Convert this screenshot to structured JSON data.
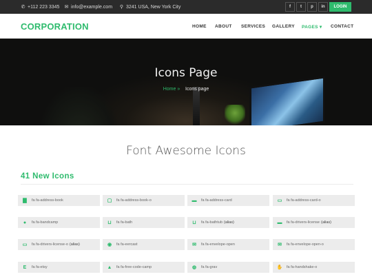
{
  "topbar": {
    "phone": "+112 223 3345",
    "email": "info@example.com",
    "address": "3241 USA, New York City",
    "social": [
      "f",
      "t",
      "p",
      "in"
    ],
    "login_label": "LOGIN"
  },
  "navbar": {
    "logo": "CORPORATION",
    "items": [
      {
        "label": "HOME"
      },
      {
        "label": "ABOUT"
      },
      {
        "label": "SERVICES"
      },
      {
        "label": "GALLERY"
      },
      {
        "label": "PAGES ▾"
      },
      {
        "label": "CONTACT"
      }
    ]
  },
  "hero": {
    "title": "Icons Page",
    "breadcrumb_home": "Home »",
    "breadcrumb_current": "Icons page"
  },
  "main": {
    "section_title": "Font Awesome Icons",
    "subsection_title": "41 New Icons",
    "icons": [
      {
        "label": "fa fa-address-book",
        "alias": "",
        "icon": "address-book-icon",
        "glyph": "▇"
      },
      {
        "label": "fa fa-address-book-o",
        "alias": "",
        "icon": "address-book-o-icon",
        "glyph": "▢"
      },
      {
        "label": "fa fa-address-card",
        "alias": "",
        "icon": "address-card-icon",
        "glyph": "▬"
      },
      {
        "label": "fa fa-address-card-o",
        "alias": "",
        "icon": "address-card-o-icon",
        "glyph": "▭"
      },
      {
        "label": "fa fa-bandcamp",
        "alias": "",
        "icon": "bandcamp-icon",
        "glyph": "●"
      },
      {
        "label": "fa fa-bath",
        "alias": "",
        "icon": "bath-icon",
        "glyph": "⊔"
      },
      {
        "label": "fa fa-bathtub",
        "alias": "(alias)",
        "icon": "bathtub-icon",
        "glyph": "⊔"
      },
      {
        "label": "fa fa-drivers-license",
        "alias": "(alias)",
        "icon": "drivers-license-icon",
        "glyph": "▬"
      },
      {
        "label": "fa fa-drivers-license-o",
        "alias": "(alias)",
        "icon": "drivers-license-o-icon",
        "glyph": "▭"
      },
      {
        "label": "fa fa-eercast",
        "alias": "",
        "icon": "eercast-icon",
        "glyph": "◉"
      },
      {
        "label": "fa fa-envelope-open",
        "alias": "",
        "icon": "envelope-open-icon",
        "glyph": "✉"
      },
      {
        "label": "fa fa-envelope-open-o",
        "alias": "",
        "icon": "envelope-open-o-icon",
        "glyph": "✉"
      },
      {
        "label": "fa fa-etsy",
        "alias": "",
        "icon": "etsy-icon",
        "glyph": "E"
      },
      {
        "label": "fa fa-free-code-camp",
        "alias": "",
        "icon": "free-code-camp-icon",
        "glyph": "▲"
      },
      {
        "label": "fa fa-grav",
        "alias": "",
        "icon": "grav-icon",
        "glyph": "◍"
      },
      {
        "label": "fa fa-handshake-o",
        "alias": "",
        "icon": "handshake-o-icon",
        "glyph": "✋"
      }
    ]
  },
  "colors": {
    "accent": "#2ebb6d",
    "topbar_bg": "#2b2b2b",
    "icon_box_bg": "#ececec"
  }
}
